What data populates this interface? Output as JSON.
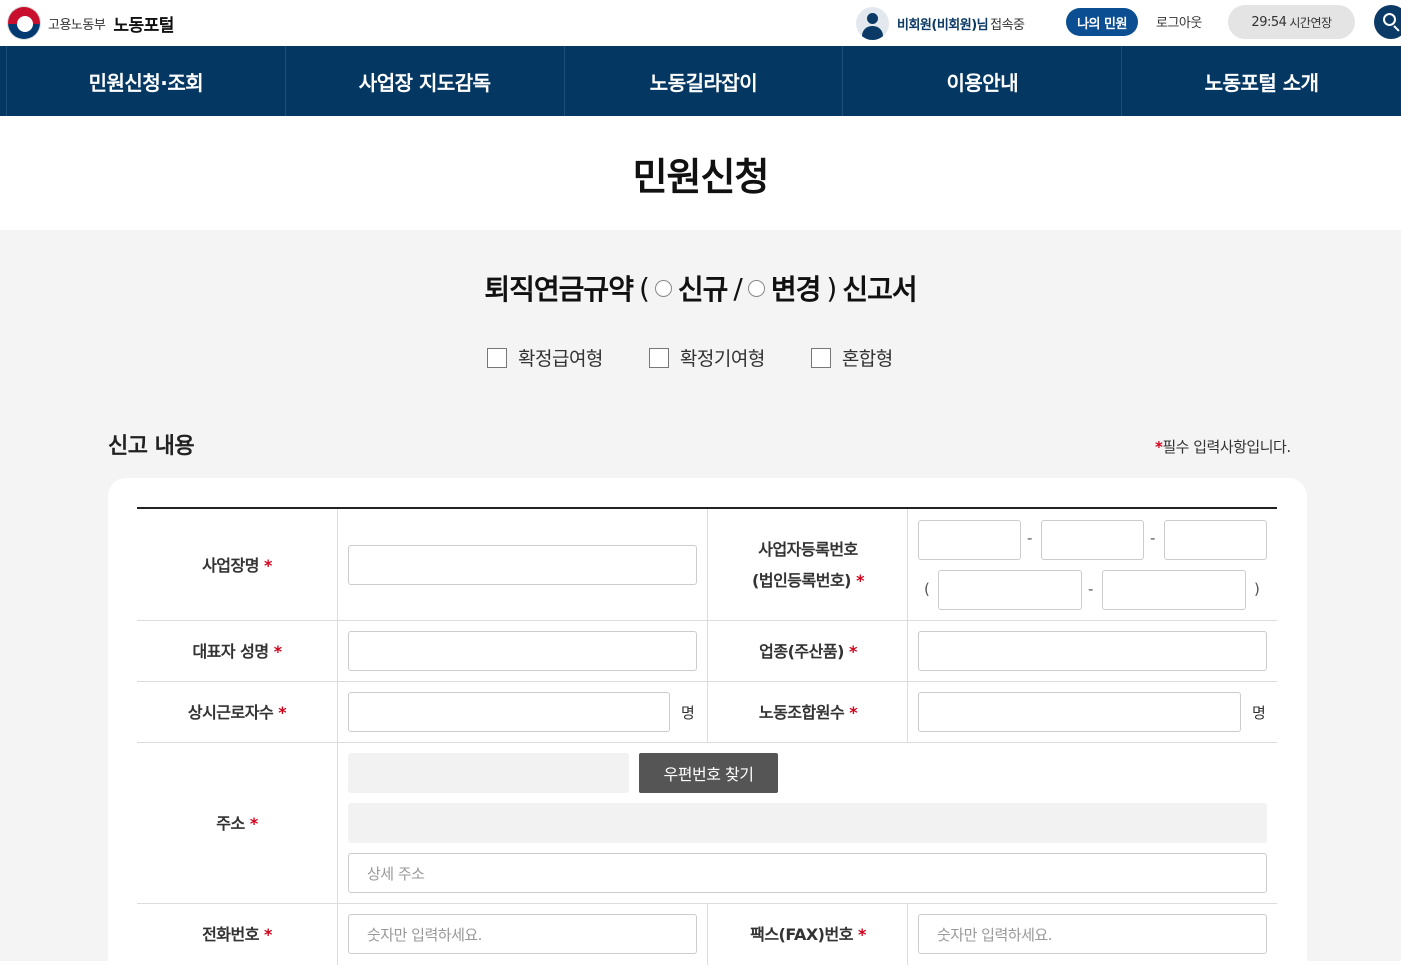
{
  "header": {
    "ministry": "고용노동부",
    "portal": "노동포털",
    "user_name": "비회원(비회원)님",
    "user_status": "접속중",
    "my_button": "나의 민원",
    "logout": "로그아웃",
    "timer": "29:54",
    "timer_label": "시간연장"
  },
  "nav": {
    "items": [
      "민원신청·조회",
      "사업장 지도감독",
      "노동길라잡이",
      "이용안내",
      "노동포털 소개"
    ]
  },
  "page_title": "민원신청",
  "form": {
    "title_main": "퇴직연금규약",
    "paren_open": "(",
    "option_new": "신규",
    "slash": "/",
    "option_change": "변경",
    "paren_close": ")",
    "title_suffix": "신고서",
    "types": [
      "확정급여형",
      "확정기여형",
      "혼합형"
    ],
    "section_title": "신고 내용",
    "required_note": "필수 입력사항입니다.",
    "required_mark": "*"
  },
  "fields": {
    "business_name": "사업장명",
    "biz_reg_no_line1": "사업자등록번호",
    "biz_reg_no_line2": "(법인등록번호)",
    "representative": "대표자 성명",
    "industry": "업종(주산품)",
    "workers": "상시근로자수",
    "union_members": "노동조합원수",
    "unit_person": "명",
    "address": "주소",
    "zip_button": "우편번호 찾기",
    "address_detail_placeholder": "상세 주소",
    "phone": "전화번호",
    "phone_placeholder": "숫자만 입력하세요.",
    "fax": "팩스(FAX)번호",
    "fax_placeholder": "숫자만 입력하세요.",
    "dash": "-",
    "paren_open": "(",
    "paren_close": ")"
  }
}
